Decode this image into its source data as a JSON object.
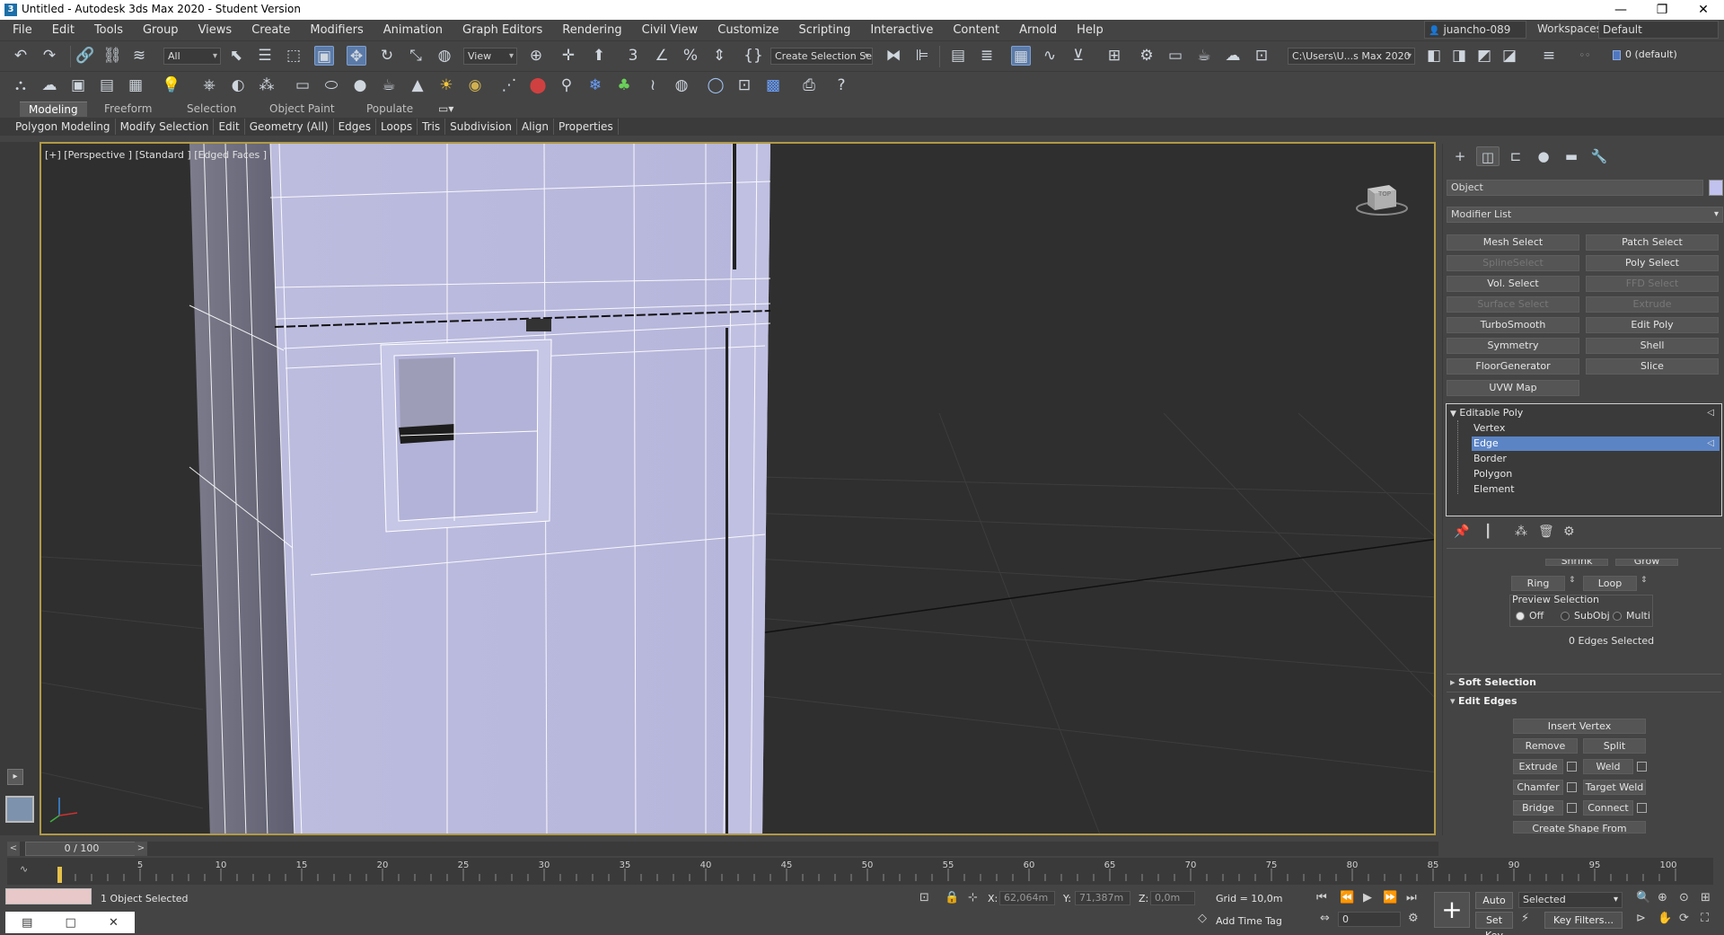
{
  "window": {
    "title": "Untitled - Autodesk 3ds Max 2020 - Student Version",
    "app_icon": "3ds-max-icon",
    "minimize": "—",
    "restore": "❐",
    "close": "✕"
  },
  "menu": [
    "File",
    "Edit",
    "Tools",
    "Group",
    "Views",
    "Create",
    "Modifiers",
    "Animation",
    "Graph Editors",
    "Rendering",
    "Civil View",
    "Customize",
    "Scripting",
    "Interactive",
    "Content",
    "Arnold",
    "Help"
  ],
  "account": {
    "user": "juancho-089",
    "workspaces_label": "Workspaces:",
    "workspace": "Default"
  },
  "toolbar1": {
    "selection_filter": "All",
    "ref_coord": "View",
    "named_selection": "Create Selection Se",
    "project_path": "C:\\Users\\U...s Max 2020",
    "layer": "0 (default)"
  },
  "ribbon": {
    "tabs": [
      "Modeling",
      "Freeform",
      "Selection",
      "Object Paint",
      "Populate"
    ],
    "active_tab": "Modeling",
    "panels": [
      "Polygon Modeling",
      "Modify Selection",
      "Edit",
      "Geometry (All)",
      "Edges",
      "Loops",
      "Tris",
      "Subdivision",
      "Align",
      "Properties"
    ]
  },
  "viewport": {
    "label": "[+] [Perspective ] [Standard ] [Edged Faces ]",
    "viewcube_label": "TOP"
  },
  "command_panel": {
    "object_name": "Object",
    "object_color": "#c2c2ee",
    "modifier_list": "Modifier List",
    "modifier_buttons": [
      {
        "label": "Mesh Select",
        "enabled": true
      },
      {
        "label": "Patch Select",
        "enabled": true
      },
      {
        "label": "SplineSelect",
        "enabled": false
      },
      {
        "label": "Poly Select",
        "enabled": true
      },
      {
        "label": "Vol. Select",
        "enabled": true
      },
      {
        "label": "FFD Select",
        "enabled": false
      },
      {
        "label": "Surface Select",
        "enabled": false
      },
      {
        "label": "Extrude",
        "enabled": false
      },
      {
        "label": "TurboSmooth",
        "enabled": true
      },
      {
        "label": "Edit Poly",
        "enabled": true
      },
      {
        "label": "Symmetry",
        "enabled": true
      },
      {
        "label": "Shell",
        "enabled": true
      },
      {
        "label": "FloorGenerator",
        "enabled": true
      },
      {
        "label": "Slice",
        "enabled": true
      },
      {
        "label": "UVW Map",
        "enabled": true
      }
    ],
    "stack": {
      "root": "Editable Poly",
      "sub_objects": [
        "Vertex",
        "Edge",
        "Border",
        "Polygon",
        "Element"
      ],
      "selected": "Edge"
    },
    "selection_rollout": {
      "shrink": "Shrink",
      "grow": "Grow",
      "ring": "Ring",
      "loop": "Loop",
      "preview_label": "Preview Selection",
      "preview_options": [
        "Off",
        "SubObj",
        "Multi"
      ],
      "preview_selected": "Off",
      "status": "0 Edges Selected"
    },
    "soft_selection": "Soft Selection",
    "edit_edges": {
      "title": "Edit Edges",
      "insert_vertex": "Insert Vertex",
      "remove": "Remove",
      "split": "Split",
      "extrude": "Extrude",
      "weld": "Weld",
      "chamfer": "Chamfer",
      "target_weld": "Target Weld",
      "bridge": "Bridge",
      "connect": "Connect",
      "create_shape": "Create Shape From Selection"
    }
  },
  "timeline": {
    "frame_display": "0 / 100",
    "ticks": [
      "5",
      "10",
      "15",
      "20",
      "25",
      "30",
      "35",
      "40",
      "45",
      "50",
      "55",
      "60",
      "65",
      "70",
      "75",
      "80",
      "85",
      "90",
      "95",
      "100"
    ]
  },
  "status": {
    "selection_info": "1 Object Selected",
    "x_label": "X:",
    "x_value": "62,064m",
    "y_label": "Y:",
    "y_value": "71,387m",
    "z_label": "Z:",
    "z_value": "0,0m",
    "grid": "Grid = 10,0m",
    "add_time_tag": "Add Time Tag",
    "auto_key": "Auto Key",
    "set_key": "Set Key",
    "key_mode": "Selected",
    "key_filters": "Key Filters...",
    "current_frame": "0"
  }
}
